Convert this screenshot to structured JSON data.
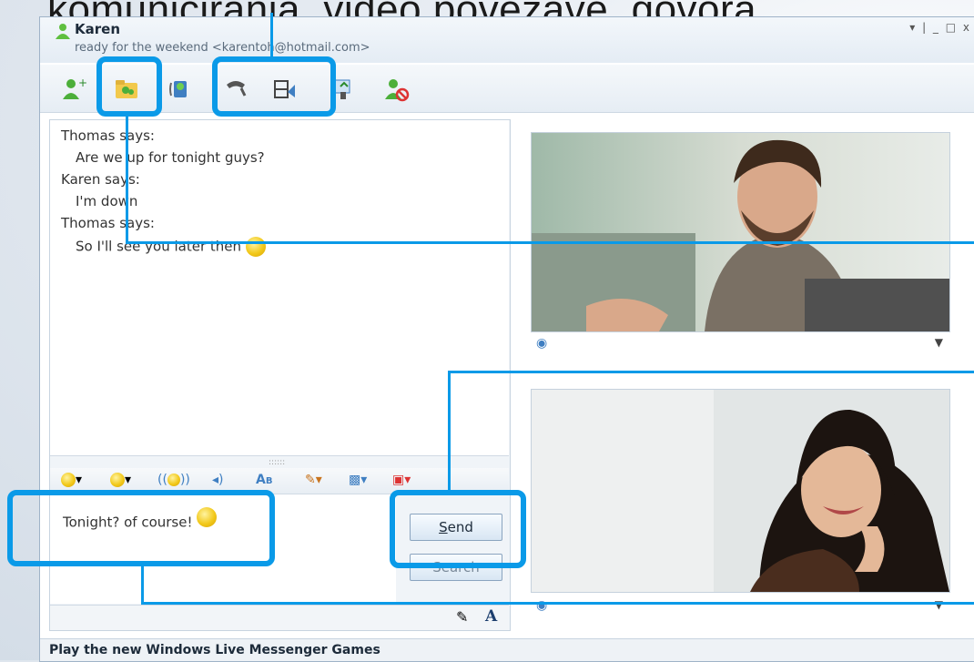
{
  "caption": "komuniciranja, video povezave, govora ...",
  "window": {
    "contact_name": "Karen",
    "contact_status": "ready for the weekend <karentoh@hotmail.com>",
    "controls": "▾ | _ □ x"
  },
  "toolbar": {
    "items": [
      "invite-contact",
      "share-folders",
      "show-webcam",
      "call",
      "video-call",
      "send-files",
      "block-contact"
    ]
  },
  "chat": {
    "lines": [
      {
        "text": "Thomas says:",
        "indent": false
      },
      {
        "text": "Are we up for tonight guys?",
        "indent": true
      },
      {
        "text": "Karen says:",
        "indent": false
      },
      {
        "text": "I'm down",
        "indent": true
      },
      {
        "text": "Thomas says:",
        "indent": false
      },
      {
        "text": "So I'll see you later then",
        "indent": true
      }
    ]
  },
  "compose": {
    "text": "Tonight? of course!",
    "send_label": "Send",
    "search_label": "Search",
    "send_underline": "S"
  },
  "format_tools": [
    "emoticon",
    "wink",
    "nudge",
    "voice-clip",
    "font",
    "draw",
    "background",
    "gift"
  ],
  "bottom_tools": [
    "pencil",
    "A"
  ],
  "status_bar": {
    "text": "Play the new Windows Live Messenger Games"
  },
  "colors": {
    "highlight": "#0a9ae8",
    "window_border": "#9fb3c8"
  }
}
